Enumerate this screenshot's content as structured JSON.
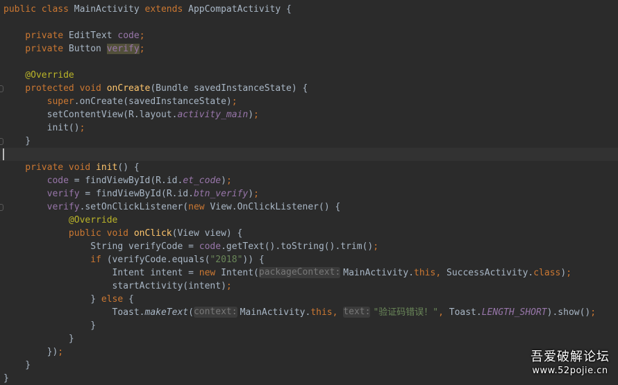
{
  "colors": {
    "background": "#2b2b2b",
    "current_line": "#323232",
    "default_text": "#a9b7c6",
    "keyword": "#cc7832",
    "field": "#9876aa",
    "method": "#ffc66d",
    "annotation": "#bbb529",
    "string": "#6a8759",
    "hint_background": "#3b3b3b",
    "hint_text": "#787878",
    "usage_highlight": "#52503a"
  },
  "editor": {
    "lines": [
      {
        "tokens": [
          {
            "t": "public class ",
            "c": "keyword"
          },
          {
            "t": "MainActivity "
          },
          {
            "t": "extends ",
            "c": "keyword"
          },
          {
            "t": "AppCompatActivity {"
          }
        ]
      },
      {
        "tokens": []
      },
      {
        "tokens": [
          {
            "t": "    private ",
            "c": "keyword"
          },
          {
            "t": "EditText "
          },
          {
            "t": "code",
            "c": "field"
          },
          {
            "t": ";",
            "c": "keyword"
          }
        ]
      },
      {
        "tokens": [
          {
            "t": "    private ",
            "c": "keyword"
          },
          {
            "t": "Button "
          },
          {
            "t": "verify",
            "c": "field hl"
          },
          {
            "t": ";",
            "c": "keyword"
          }
        ]
      },
      {
        "tokens": []
      },
      {
        "tokens": [
          {
            "t": "    @Override",
            "c": "annotation"
          }
        ]
      },
      {
        "gutter": true,
        "tokens": [
          {
            "t": "    protected void ",
            "c": "keyword"
          },
          {
            "t": "onCreate",
            "c": "method"
          },
          {
            "t": "(Bundle savedInstanceState) {"
          }
        ]
      },
      {
        "tokens": [
          {
            "t": "        super",
            "c": "keyword"
          },
          {
            "t": ".onCreate(savedInstanceState)"
          },
          {
            "t": ";",
            "c": "keyword"
          }
        ]
      },
      {
        "tokens": [
          {
            "t": "        setContentView(R.layout."
          },
          {
            "t": "activity_main",
            "c": "italic-field"
          },
          {
            "t": ")"
          },
          {
            "t": ";",
            "c": "keyword"
          }
        ]
      },
      {
        "tokens": [
          {
            "t": "        init()"
          },
          {
            "t": ";",
            "c": "keyword"
          }
        ]
      },
      {
        "gutter": true,
        "tokens": [
          {
            "t": "    }"
          }
        ]
      },
      {
        "current": true,
        "caret": true,
        "tokens": []
      },
      {
        "tokens": [
          {
            "t": "    private void ",
            "c": "keyword"
          },
          {
            "t": "init",
            "c": "method"
          },
          {
            "t": "() {"
          }
        ]
      },
      {
        "tokens": [
          {
            "t": "        "
          },
          {
            "t": "code",
            "c": "field"
          },
          {
            "t": " = findViewById(R.id."
          },
          {
            "t": "et_code",
            "c": "italic-field"
          },
          {
            "t": ")"
          },
          {
            "t": ";",
            "c": "keyword"
          }
        ]
      },
      {
        "tokens": [
          {
            "t": "        "
          },
          {
            "t": "verify",
            "c": "field"
          },
          {
            "t": " = findViewById(R.id."
          },
          {
            "t": "btn_verify",
            "c": "italic-field"
          },
          {
            "t": ")"
          },
          {
            "t": ";",
            "c": "keyword"
          }
        ]
      },
      {
        "gutter": true,
        "tokens": [
          {
            "t": "        "
          },
          {
            "t": "verify",
            "c": "field"
          },
          {
            "t": ".setOnClickListener("
          },
          {
            "t": "new ",
            "c": "keyword"
          },
          {
            "t": "View.OnClickListener() {"
          }
        ]
      },
      {
        "tokens": [
          {
            "t": "            @Override",
            "c": "annotation"
          }
        ]
      },
      {
        "tokens": [
          {
            "t": "            public void ",
            "c": "keyword"
          },
          {
            "t": "onClick",
            "c": "method"
          },
          {
            "t": "(View view) {"
          }
        ]
      },
      {
        "tokens": [
          {
            "t": "                String verifyCode = "
          },
          {
            "t": "code",
            "c": "field"
          },
          {
            "t": ".getText().toString().trim()"
          },
          {
            "t": ";",
            "c": "keyword"
          }
        ]
      },
      {
        "tokens": [
          {
            "t": "                if ",
            "c": "keyword"
          },
          {
            "t": "(verifyCode.equals("
          },
          {
            "t": "\"2018\"",
            "c": "string"
          },
          {
            "t": ")) {"
          }
        ]
      },
      {
        "tokens": [
          {
            "t": "                    Intent intent = "
          },
          {
            "t": "new ",
            "c": "keyword"
          },
          {
            "t": "Intent("
          },
          {
            "t": "packageContext:",
            "c": "hint"
          },
          {
            "t": "MainActivity."
          },
          {
            "t": "this",
            "c": "keyword"
          },
          {
            "t": ", ",
            "c": "keyword"
          },
          {
            "t": "SuccessActivity."
          },
          {
            "t": "class",
            "c": "keyword"
          },
          {
            "t": ")"
          },
          {
            "t": ";",
            "c": "keyword"
          }
        ]
      },
      {
        "tokens": [
          {
            "t": "                    startActivity(intent)"
          },
          {
            "t": ";",
            "c": "keyword"
          }
        ]
      },
      {
        "tokens": [
          {
            "t": "                } "
          },
          {
            "t": "else ",
            "c": "keyword"
          },
          {
            "t": "{"
          }
        ]
      },
      {
        "tokens": [
          {
            "t": "                    Toast."
          },
          {
            "t": "makeText",
            "c": "static"
          },
          {
            "t": "("
          },
          {
            "t": "context:",
            "c": "hint"
          },
          {
            "t": "MainActivity."
          },
          {
            "t": "this",
            "c": "keyword"
          },
          {
            "t": ", ",
            "c": "keyword"
          },
          {
            "t": "text:",
            "c": "hint"
          },
          {
            "t": "\"验证码错误！\"",
            "c": "string"
          },
          {
            "t": ", ",
            "c": "keyword"
          },
          {
            "t": "Toast."
          },
          {
            "t": "LENGTH_SHORT",
            "c": "italic-field"
          },
          {
            "t": ").show()"
          },
          {
            "t": ";",
            "c": "keyword"
          }
        ]
      },
      {
        "tokens": [
          {
            "t": "                }"
          }
        ]
      },
      {
        "tokens": [
          {
            "t": "            }"
          }
        ]
      },
      {
        "tokens": [
          {
            "t": "        })"
          },
          {
            "t": ";",
            "c": "keyword"
          }
        ]
      },
      {
        "tokens": [
          {
            "t": "    }"
          }
        ]
      },
      {
        "tokens": [
          {
            "t": "}"
          }
        ]
      }
    ]
  },
  "watermark": {
    "title": "吾爱破解论坛",
    "url": "www.52pojie.cn"
  }
}
